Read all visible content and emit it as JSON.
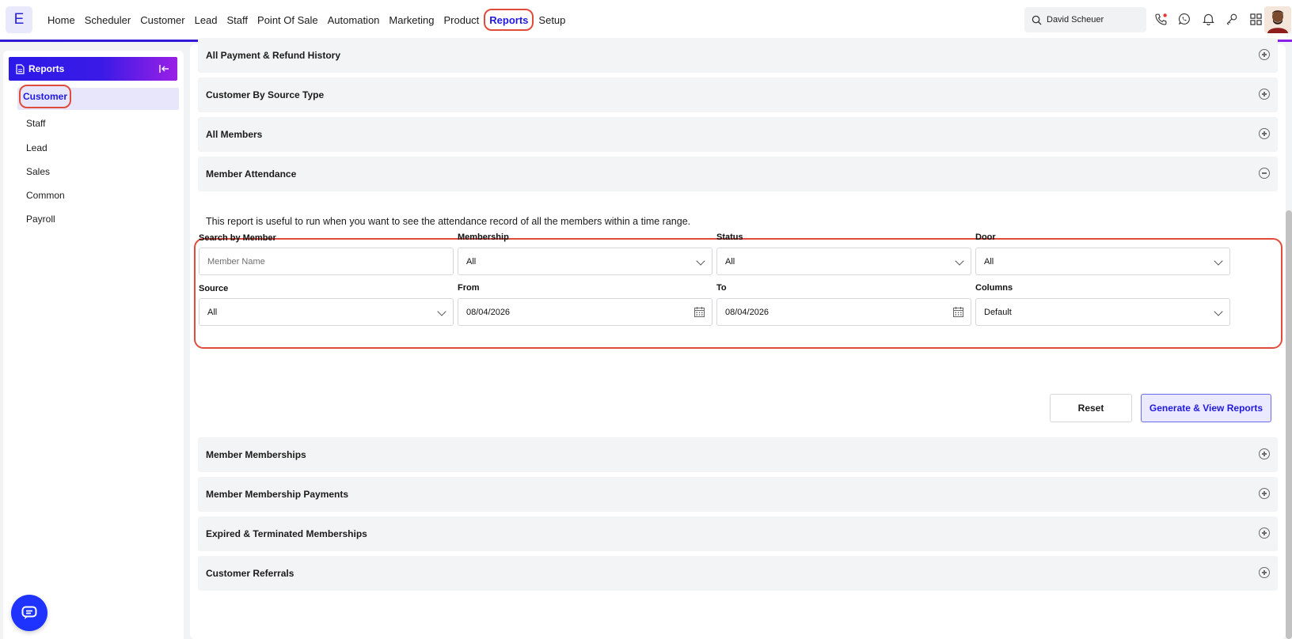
{
  "app": {
    "logo_letter": "E"
  },
  "nav": {
    "items": [
      {
        "label": "Home"
      },
      {
        "label": "Scheduler"
      },
      {
        "label": "Customer"
      },
      {
        "label": "Lead"
      },
      {
        "label": "Staff"
      },
      {
        "label": "Point Of Sale"
      },
      {
        "label": "Automation"
      },
      {
        "label": "Marketing"
      },
      {
        "label": "Product"
      },
      {
        "label": "Reports",
        "active": true
      },
      {
        "label": "Setup"
      }
    ],
    "search_value": "David Scheuer"
  },
  "sidebar": {
    "title": "Reports",
    "items": [
      {
        "label": "Customer",
        "active": true
      },
      {
        "label": "Staff"
      },
      {
        "label": "Lead"
      },
      {
        "label": "Sales"
      },
      {
        "label": "Common"
      },
      {
        "label": "Payroll"
      }
    ]
  },
  "accordions_top": [
    {
      "title": "All Payment & Refund History",
      "state": "collapsed"
    },
    {
      "title": "Customer By Source Type",
      "state": "collapsed"
    },
    {
      "title": "All Members",
      "state": "collapsed"
    },
    {
      "title": "Member Attendance",
      "state": "expanded"
    }
  ],
  "report": {
    "description": "This report is useful to run when you want to see the attendance record of all the members within a time range.",
    "filters": {
      "search_by_member": {
        "label": "Search by Member",
        "placeholder": "Member Name"
      },
      "membership": {
        "label": "Membership",
        "value": "All"
      },
      "status": {
        "label": "Status",
        "value": "All"
      },
      "door": {
        "label": "Door",
        "value": "All"
      },
      "source": {
        "label": "Source",
        "value": "All"
      },
      "from": {
        "label": "From",
        "value": "08/04/2026"
      },
      "to": {
        "label": "To",
        "value": "08/04/2026"
      },
      "columns": {
        "label": "Columns",
        "value": "Default"
      }
    },
    "reset_label": "Reset",
    "generate_label": "Generate & View Reports"
  },
  "accordions_bottom": [
    {
      "title": "Member Memberships",
      "state": "collapsed"
    },
    {
      "title": "Member Membership Payments",
      "state": "collapsed"
    },
    {
      "title": "Expired & Terminated Memberships",
      "state": "collapsed"
    },
    {
      "title": "Customer Referrals",
      "state": "collapsed"
    }
  ],
  "colors": {
    "accent": "#2119e0",
    "highlight": "#e04c3c",
    "fab": "#1e33ff"
  }
}
